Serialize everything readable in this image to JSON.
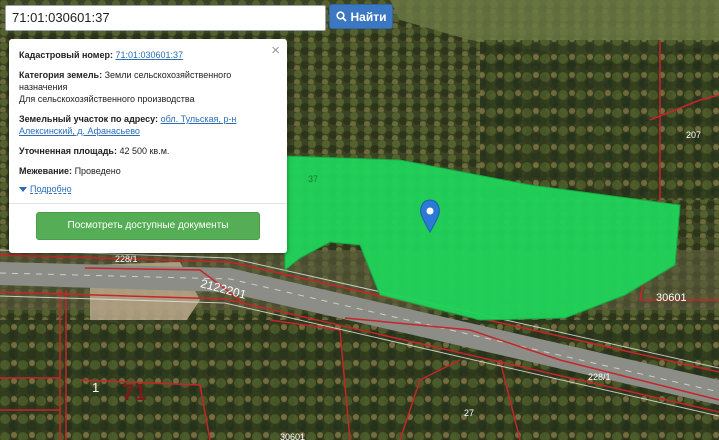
{
  "search": {
    "value": "71:01:030601:37",
    "button_label": "Найти",
    "button_icon": "search-icon"
  },
  "popup": {
    "cadastral_label": "Кадастровый номер:",
    "cadastral_value": "71:01:030601:37",
    "category_label": "Категория земель:",
    "category_value": "Земли сельскохозяйственного назначения",
    "usage_value": "Для сельскохозяйственного производства",
    "address_label": "Земельный участок по адресу:",
    "address_value": "обл. Тульская, р-н Алексинский, д. Афанасьево",
    "area_label": "Уточненная площадь:",
    "area_value": "42 500 кв.м.",
    "survey_label": "Межевание:",
    "survey_value": "Проведено",
    "details_label": "Подробно",
    "docs_button": "Посмотреть доступные документы",
    "close_icon": "close-icon"
  },
  "map": {
    "colors": {
      "parcel_fill": "#1fd45a",
      "parcel_stroke": "#14b048",
      "boundary": "#c8242a",
      "marker": "#2b7bd6"
    },
    "labels": {
      "parcel_37": "37",
      "parcel_207": "207",
      "parcel_2281_left": "228/1",
      "parcel_2122201": "2122201",
      "parcel_30601": "30601",
      "parcel_2281_right": "228/1",
      "parcel_1": "1",
      "block_71": "71",
      "parcel_27": "27",
      "parcel_bottom": "30601"
    }
  }
}
